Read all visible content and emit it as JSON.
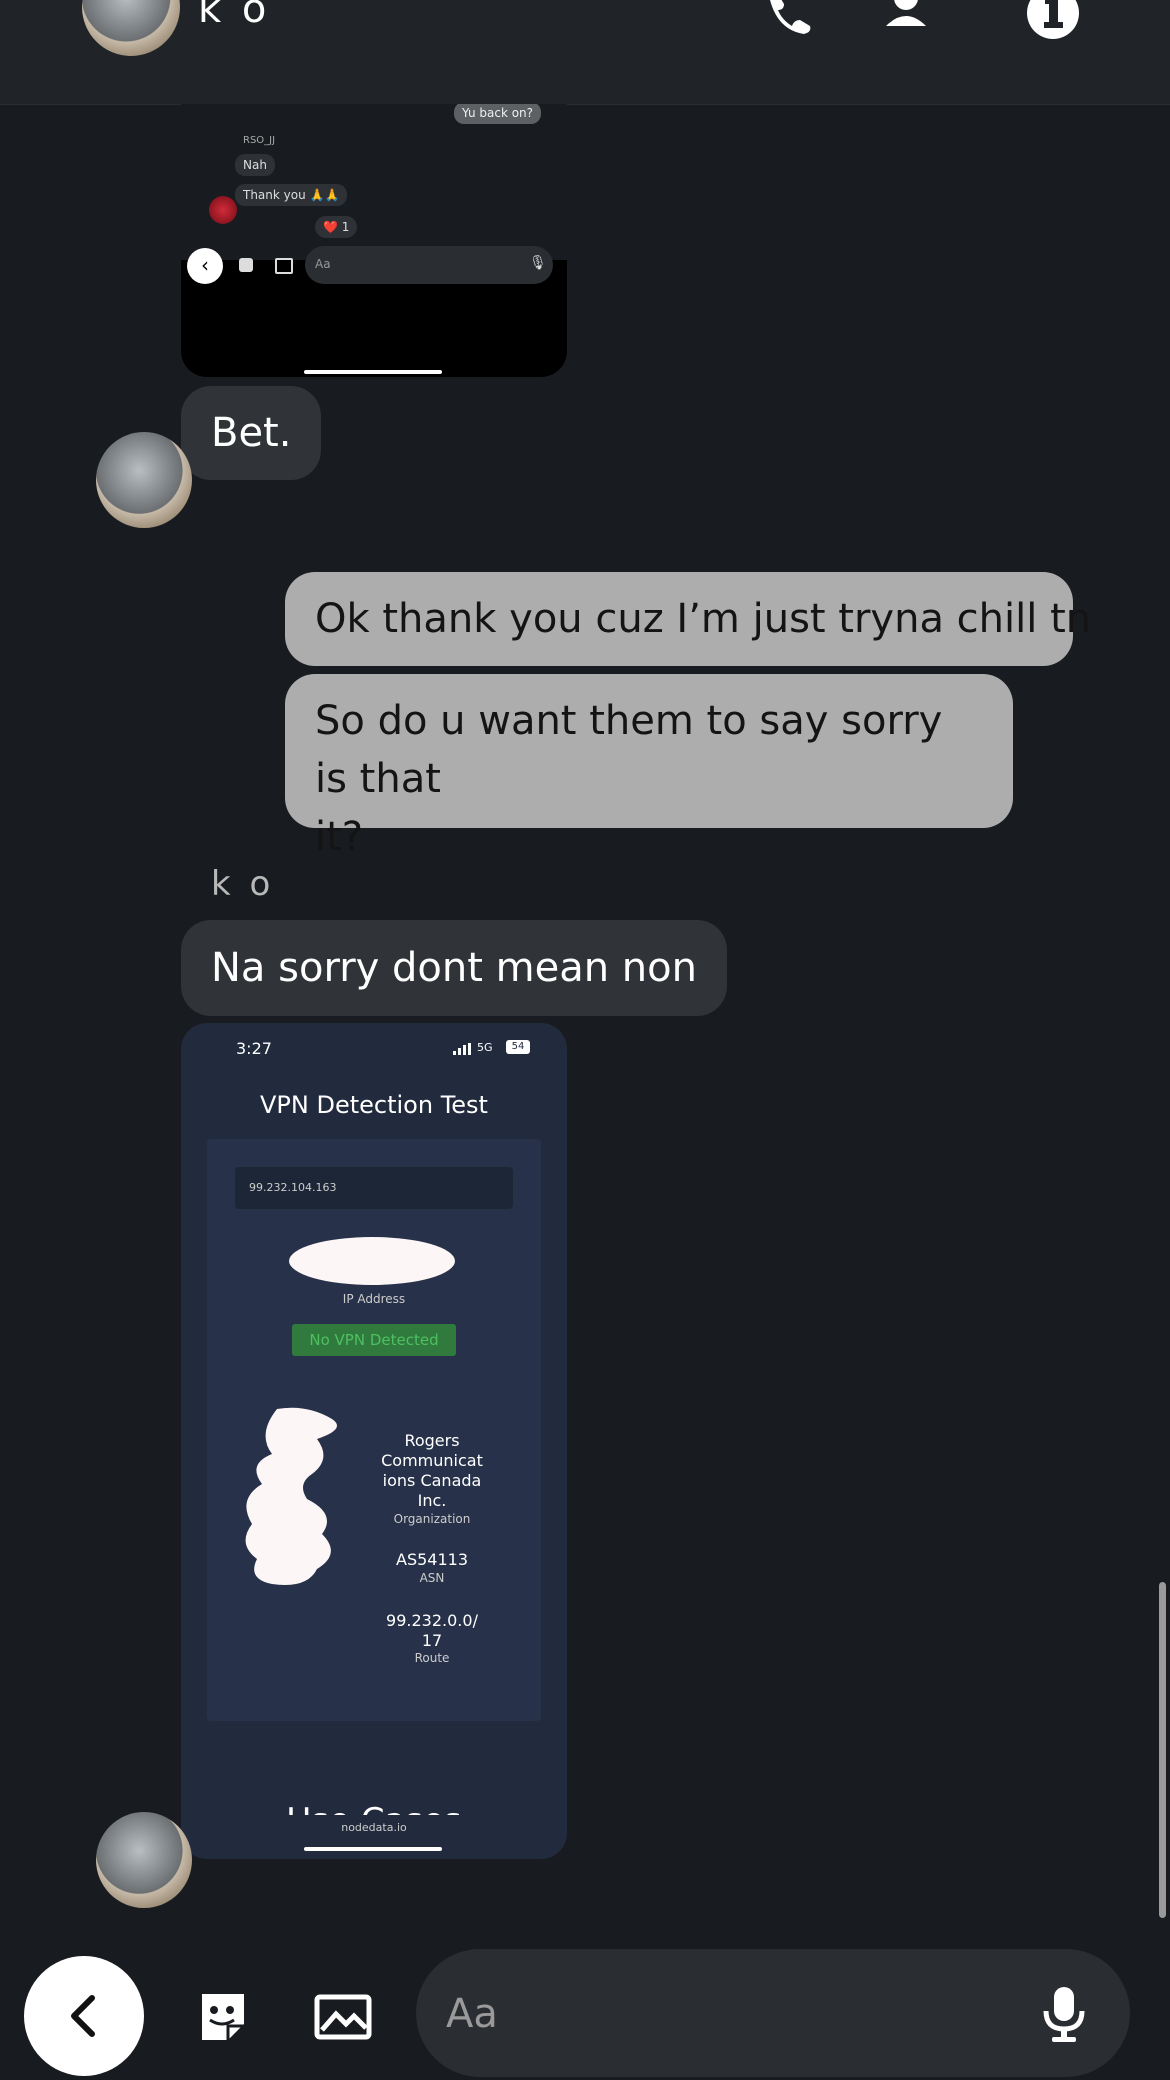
{
  "header": {
    "title": "k o"
  },
  "embedded_screenshot_1": {
    "sent_text": "Yu back on?",
    "sender_name": "RSO_JJ",
    "messages": [
      "Nah",
      "Thank you 🙏🙏"
    ],
    "reaction": "❤️ 1",
    "composer_placeholder": "Aa"
  },
  "messages": {
    "bet": "Bet.",
    "out_1": "Ok thank you cuz I’m just tryna chill tn",
    "out_2_line1": "So do u want them to say sorry is that",
    "out_2_line2": "it?",
    "sender_label": "k o",
    "in_2": "Na sorry dont mean non"
  },
  "embedded_screenshot_2": {
    "time": "3:27",
    "network": "5G",
    "battery": "54",
    "title": "VPN Detection Test",
    "ip_value": "99.232.104.163",
    "ip_label": "IP Address",
    "status": "No VPN Detected",
    "org_lines": [
      "Rogers",
      "Communicat",
      "ions Canada",
      "Inc."
    ],
    "org_label": "Organization",
    "asn_value": "AS54113",
    "asn_label": "ASN",
    "route_lines": [
      "99.232.0.0/",
      "17"
    ],
    "route_label": "Route",
    "footer_partial": "Use Cases",
    "domain": "nodedata.io"
  },
  "composer": {
    "placeholder": "Aa"
  },
  "colors": {
    "background": "#181b1f",
    "incoming_bubble": "#303438",
    "outgoing_bubble": "#adadad",
    "status_green": "#2f7a3c"
  }
}
